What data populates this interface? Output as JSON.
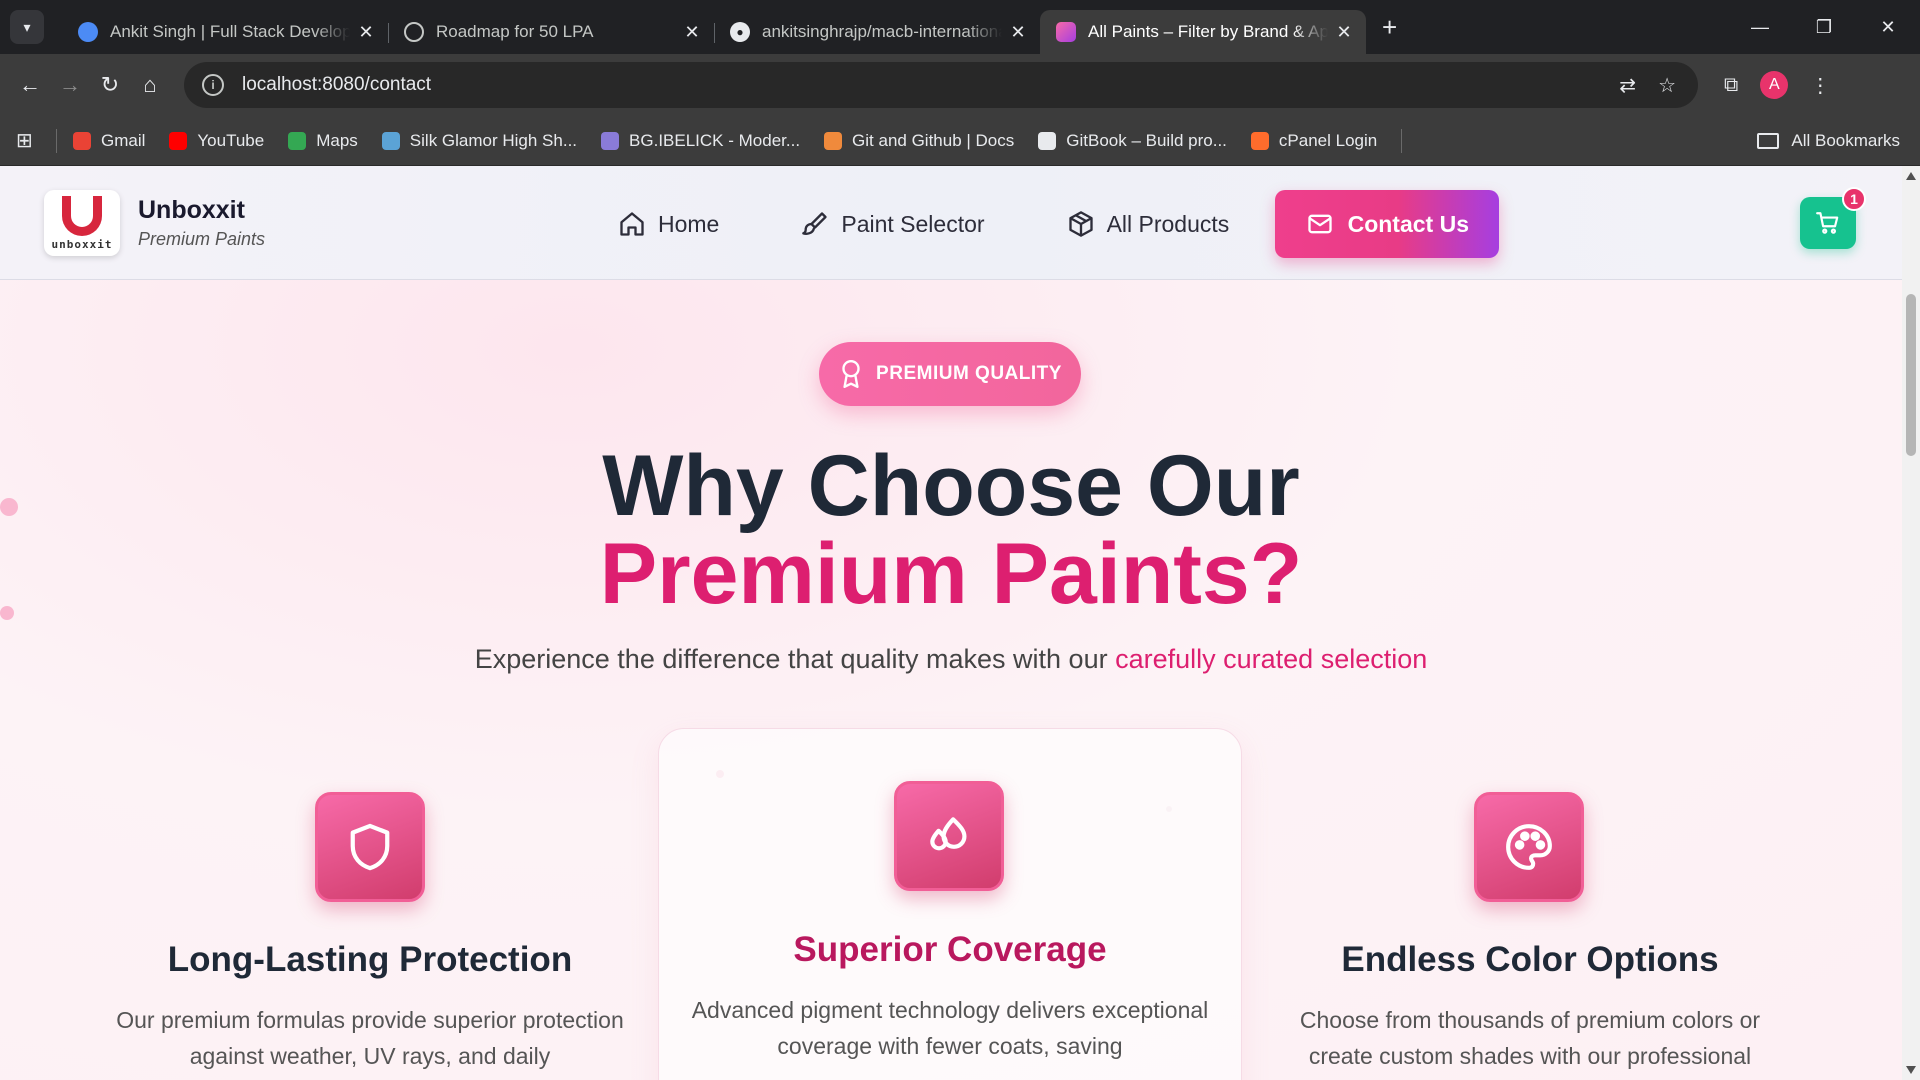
{
  "browser": {
    "tabs": [
      {
        "title": "Ankit Singh | Full Stack Developer",
        "favicon": "portfolio-favicon",
        "active": false
      },
      {
        "title": "Roadmap for 50 LPA",
        "favicon": "openai-favicon",
        "active": false
      },
      {
        "title": "ankitsinghrajp/macb-international",
        "favicon": "github-favicon",
        "active": false
      },
      {
        "title": "All Paints – Filter by Brand & Application",
        "favicon": "paints-favicon",
        "active": true
      }
    ],
    "url": "localhost:8080/contact",
    "profile_initial": "A",
    "bookmarks": [
      {
        "label": "Gmail",
        "icon": "gmail-icon",
        "color": "#ea4335"
      },
      {
        "label": "YouTube",
        "icon": "youtube-icon",
        "color": "#ff0000"
      },
      {
        "label": "Maps",
        "icon": "maps-icon",
        "color": "#34a853"
      },
      {
        "label": "Silk Glamor High Sh...",
        "icon": "silk-icon",
        "color": "#5ba3d6"
      },
      {
        "label": "BG.IBELICK - Moder...",
        "icon": "hash-icon",
        "color": "#8a7bd8"
      },
      {
        "label": "Git and Github | Docs",
        "icon": "git-icon",
        "color": "#f08a3c"
      },
      {
        "label": "GitBook – Build pro...",
        "icon": "gitbook-icon",
        "color": "#e8eaed"
      },
      {
        "label": "cPanel Login",
        "icon": "cpanel-icon",
        "color": "#ff6c2c"
      }
    ],
    "all_bookmarks": "All Bookmarks"
  },
  "header": {
    "logo_text": "unboxxit",
    "brand_name": "Unboxxit",
    "brand_tagline": "Premium Paints",
    "nav": [
      {
        "label": "Home",
        "icon": "home-icon"
      },
      {
        "label": "Paint Selector",
        "icon": "paintbrush-icon"
      },
      {
        "label": "All Products",
        "icon": "package-icon"
      }
    ],
    "cta": "Contact Us",
    "cart_count": "1"
  },
  "hero": {
    "badge": "PREMIUM QUALITY",
    "title_line1": "Why Choose Our",
    "title_line2": "Premium Paints?",
    "subtitle_prefix": "Experience the difference that quality makes with our",
    "subtitle_highlight": "carefully curated selection"
  },
  "features": [
    {
      "title": "Long-Lasting Protection",
      "icon": "shield-icon",
      "desc": "Our premium formulas provide superior protection against weather, UV rays, and daily"
    },
    {
      "title": "Superior Coverage",
      "icon": "droplets-icon",
      "desc": "Advanced pigment technology delivers exceptional coverage with fewer coats, saving"
    },
    {
      "title": "Endless Color Options",
      "icon": "palette-icon",
      "desc": "Choose from thousands of premium colors or create custom shades with our professional"
    }
  ],
  "colors": {
    "accent_pink": "#dd1f70",
    "cta_gradient_start": "#ef3f8c",
    "cta_gradient_end": "#a63ee0",
    "cart_green": "#16c28f"
  }
}
